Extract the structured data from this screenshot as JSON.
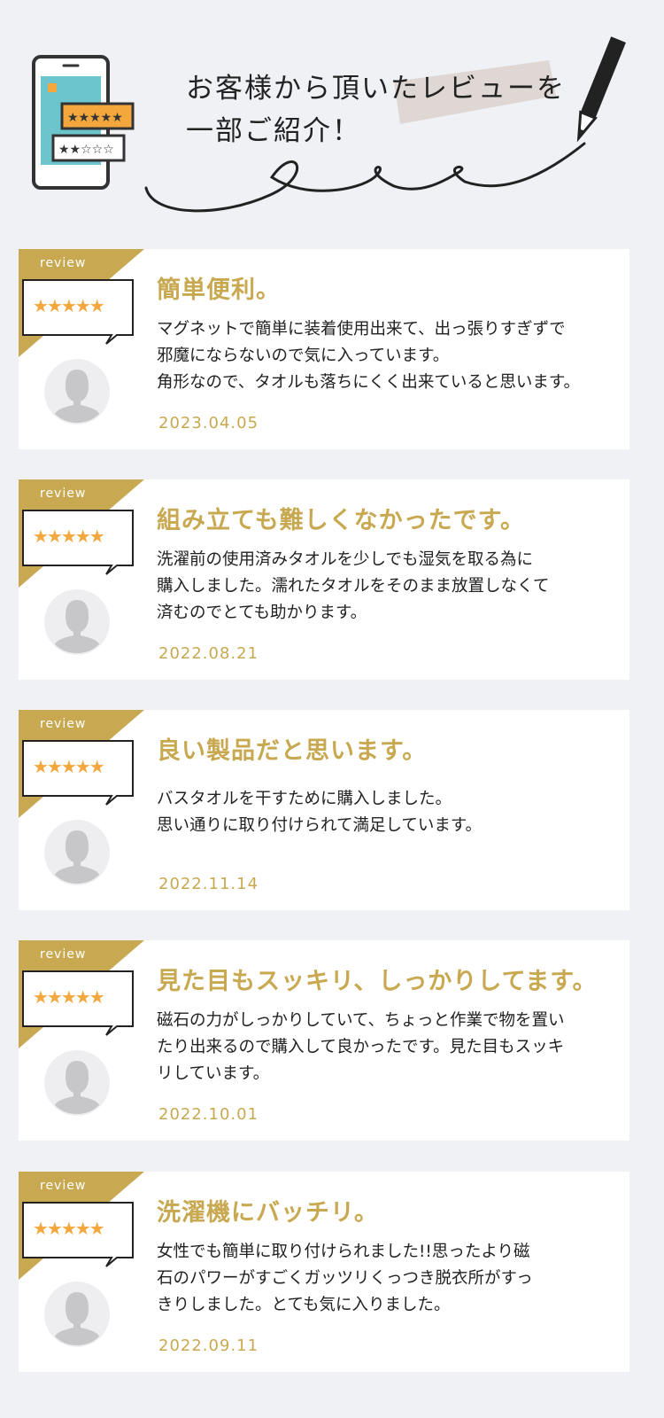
{
  "header": {
    "heading_lines": [
      "お客様から頂いたレビューを",
      "一部ご紹介！"
    ],
    "icons": [
      "phone-review-icon",
      "pencil-icon"
    ]
  },
  "colors": {
    "gold": "#c8a951",
    "star": "#f4a73c",
    "background": "#f0f1f5"
  },
  "reviews": [
    {
      "label": "review",
      "stars": "★★★★★",
      "rating": 5,
      "title": "簡単便利。",
      "lines": [
        "マグネットで簡単に装着使用出来て、出っ張りすぎずで",
        "邪魔にならないので気に入っています。",
        "角形なので、タオルも落ちにくく出来ていると思います。"
      ],
      "date": "2023.04.05"
    },
    {
      "label": "review",
      "stars": "★★★★★",
      "rating": 5,
      "title": "組み立ても難しくなかったです。",
      "lines": [
        "洗濯前の使用済みタオルを少しでも湿気を取る為に",
        "購入しました。濡れたタオルをそのまま放置しなくて",
        "済むのでとても助かります。"
      ],
      "date": "2022.08.21"
    },
    {
      "label": "review",
      "stars": "★★★★★",
      "rating": 5,
      "title": "良い製品だと思います。",
      "lines": [
        "バスタオルを干すために購入しました。",
        "思い通りに取り付けられて満足しています。"
      ],
      "date": "2022.11.14"
    },
    {
      "label": "review",
      "stars": "★★★★★",
      "rating": 5,
      "title": "見た目もスッキリ、しっかりしてます。",
      "lines": [
        "磁石の力がしっかりしていて、ちょっと作業で物を置い",
        "たり出来るので購入して良かったです。見た目もスッキ",
        "リしています。"
      ],
      "date": "2022.10.01"
    },
    {
      "label": "review",
      "stars": "★★★★★",
      "rating": 5,
      "title": "洗濯機にバッチリ。",
      "lines": [
        "女性でも簡単に取り付けられました!!思ったより磁",
        "石のパワーがすごくガッツリくっつき脱衣所がすっ",
        "きりしました。とても気に入りました。"
      ],
      "date": "2022.09.11"
    }
  ]
}
